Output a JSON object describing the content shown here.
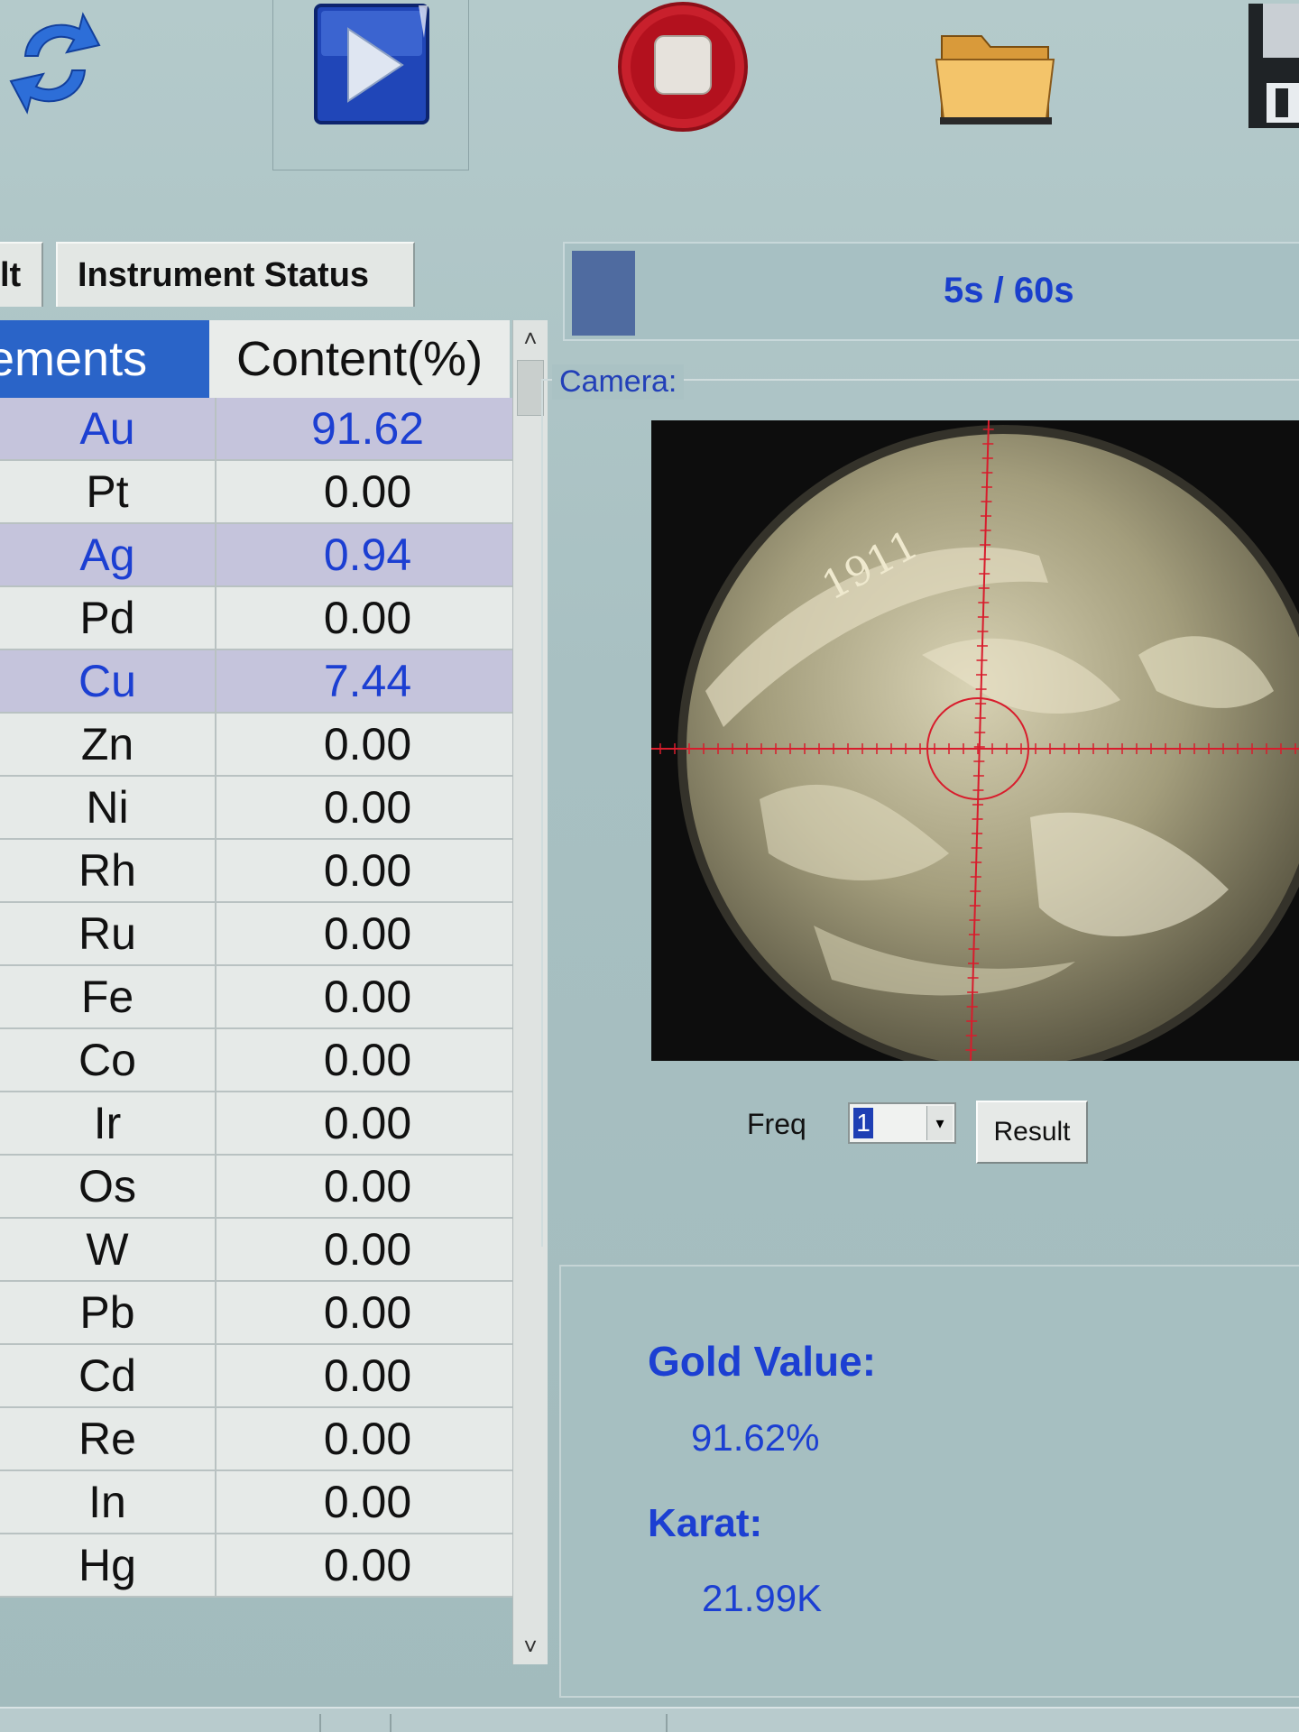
{
  "tabs": {
    "result_partial": "lt",
    "instrument_status": "Instrument Status"
  },
  "progress": {
    "text": "5s / 60s",
    "fraction": 0.0833
  },
  "table": {
    "header_elements": "ements",
    "header_content": "Content(%)",
    "rows": [
      {
        "element": "Au",
        "content": "91.62",
        "detected": true
      },
      {
        "element": "Pt",
        "content": "0.00",
        "detected": false
      },
      {
        "element": "Ag",
        "content": "0.94",
        "detected": true
      },
      {
        "element": "Pd",
        "content": "0.00",
        "detected": false
      },
      {
        "element": "Cu",
        "content": "7.44",
        "detected": true
      },
      {
        "element": "Zn",
        "content": "0.00",
        "detected": false
      },
      {
        "element": "Ni",
        "content": "0.00",
        "detected": false
      },
      {
        "element": "Rh",
        "content": "0.00",
        "detected": false
      },
      {
        "element": "Ru",
        "content": "0.00",
        "detected": false
      },
      {
        "element": "Fe",
        "content": "0.00",
        "detected": false
      },
      {
        "element": "Co",
        "content": "0.00",
        "detected": false
      },
      {
        "element": "Ir",
        "content": "0.00",
        "detected": false
      },
      {
        "element": "Os",
        "content": "0.00",
        "detected": false
      },
      {
        "element": "W",
        "content": "0.00",
        "detected": false
      },
      {
        "element": "Pb",
        "content": "0.00",
        "detected": false
      },
      {
        "element": "Cd",
        "content": "0.00",
        "detected": false
      },
      {
        "element": "Re",
        "content": "0.00",
        "detected": false
      },
      {
        "element": "In",
        "content": "0.00",
        "detected": false
      },
      {
        "element": "Hg",
        "content": "0.00",
        "detected": false
      }
    ]
  },
  "camera": {
    "label": "Camera:",
    "freq_label": "Freq",
    "freq_value": "1",
    "result_button": "Result",
    "coin_inscription": "1911"
  },
  "result": {
    "gold_label": "Gold Value:",
    "gold_value": "91.62%",
    "karat_label": "Karat:",
    "karat_value": "21.99K"
  },
  "icons": {
    "refresh": "refresh-icon",
    "play": "play-icon",
    "stop": "stop-icon",
    "open": "folder-icon",
    "save": "save-icon"
  },
  "colors": {
    "accent_blue": "#1c3fd2",
    "header_blue": "#2a64c8",
    "detected_row": "#c5c4dc",
    "crosshair": "#d81c2c"
  }
}
